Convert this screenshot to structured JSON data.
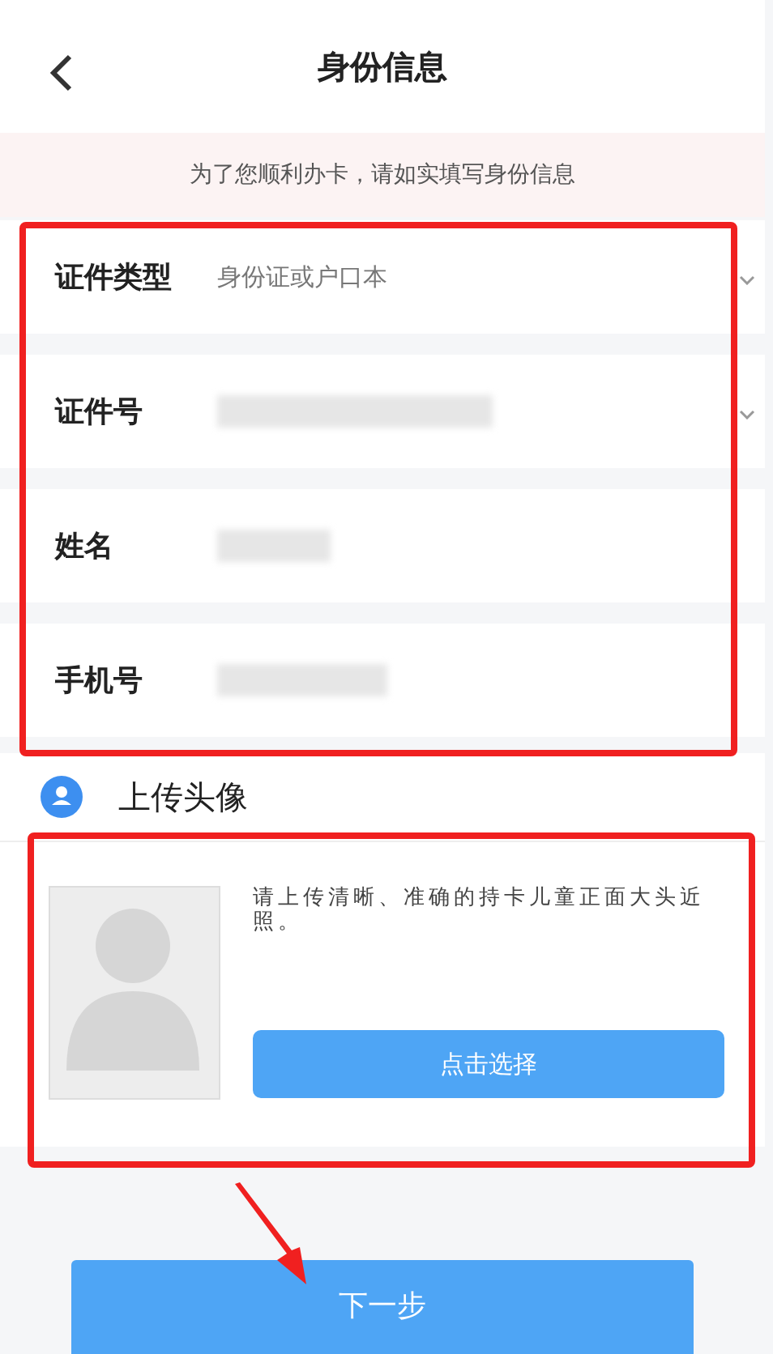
{
  "header": {
    "title": "身份信息"
  },
  "notice": "为了您顺利办卡，请如实填写身份信息",
  "fields": [
    {
      "label": "证件类型",
      "value": "身份证或户口本",
      "redacted": false,
      "dropdown": true
    },
    {
      "label": "证件号",
      "redacted": true,
      "dropdown": true
    },
    {
      "label": "姓名",
      "redacted": true,
      "dropdown": false
    },
    {
      "label": "手机号",
      "redacted": true,
      "dropdown": false
    }
  ],
  "upload": {
    "title": "上传头像",
    "hint": "请上传清晰、准确的持卡儿童正面大头近照。",
    "button": "点击选择"
  },
  "next_button": "下一步"
}
